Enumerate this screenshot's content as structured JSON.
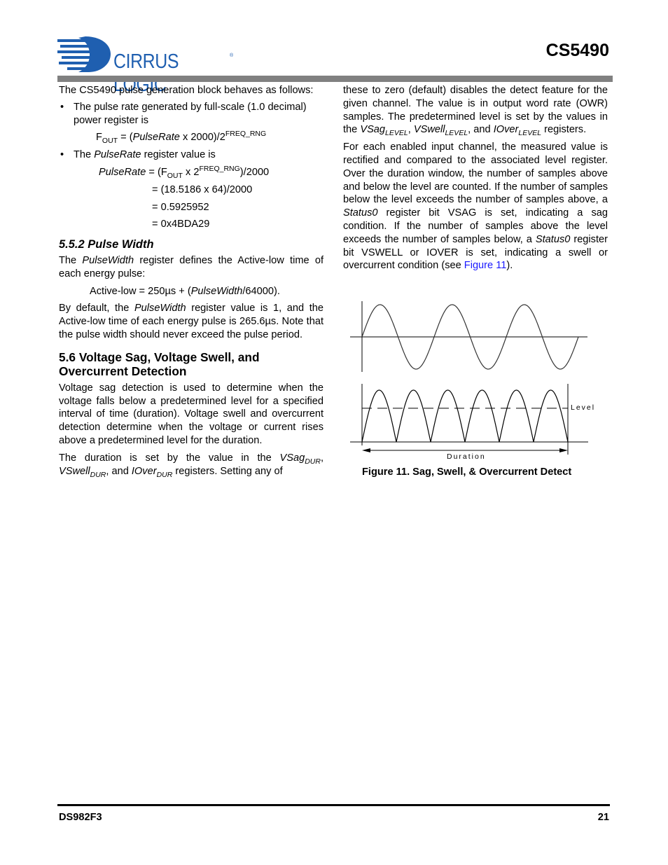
{
  "header": {
    "logo_text": "CIRRUS LOGIC",
    "logo_registered": "®",
    "part_number": "CS5490",
    "brand_color": "#1f5fb0",
    "bar_color": "#808080"
  },
  "left_column": {
    "intro": "The CS5490 pulse generation block behaves as follows:",
    "bullet1": {
      "marker": "•",
      "text": "The pulse rate generated by full-scale (1.0 decimal) power register is",
      "eq": {
        "f": "F",
        "f_sub": "OUT",
        "mid1": " = (",
        "var": "PulseRate",
        "mid2": " x 2000)/2",
        "exp": "FREQ_RNG"
      }
    },
    "bullet2": {
      "marker": "•",
      "text_pre": "The ",
      "text_var": "PulseRate",
      "text_post": " register value is",
      "eq_line1": {
        "var": "PulseRate",
        "mid1": " = (F",
        "sub": "OUT",
        "mid2": " x 2",
        "exp": "FREQ_RNG",
        "end": ")/2000"
      },
      "eq_line2": "= (18.5186 x 64)/2000",
      "eq_line3": "= 0.5925952",
      "eq_line4": "= 0x4BDA29"
    },
    "section_552": {
      "heading": "5.5.2  Pulse Width",
      "p1_pre": "The ",
      "p1_var": "PulseWidth",
      "p1_post": " register defines the Active-low time of each energy pulse:",
      "eq_pre": "Active-low = 250µs + (",
      "eq_var": "PulseWidth",
      "eq_post": "/64000).",
      "p2_pre": "By default, the ",
      "p2_var": "PulseWidth",
      "p2_post": " register value is 1, and the Active-low time of each energy pulse is 265.6µs. Note that the pulse width should never exceed the pulse period."
    },
    "section_56": {
      "heading_line1": "5.6  Voltage Sag, Voltage Swell, and",
      "heading_line2": "Overcurrent Detection",
      "p1": "Voltage sag detection is used to determine when the voltage falls below a predetermined level for a specified interval of time (duration). Voltage swell and overcurrent detection determine when the voltage or current rises above a predetermined level for the duration.",
      "p2_pre": "The duration is set by the value in the ",
      "r1": "VSag",
      "r1_sub": "DUR",
      "sep1": ", ",
      "r2": "VSwell",
      "r2_sub": "DUR",
      "sep2": ", and ",
      "r3": "IOver",
      "r3_sub": "DUR",
      "p2_post": " registers. Setting any of"
    }
  },
  "right_column": {
    "p1_pre": "these to zero (default) disables the detect feature for the given channel. The value is in output word rate (OWR) samples. The predetermined level is set by the values in the ",
    "r1": "VSag",
    "r1_sub": "LEVEL",
    "sep1": ", ",
    "r2": "VSwell",
    "r2_sub": "LEVEL",
    "sep2": ", and ",
    "r3": "IOver",
    "r3_sub": "LEVEL",
    "p1_post": " registers.",
    "p2_a": "For each enabled input channel, the measured value is rectified and compared to the associated level register. Over the duration window, the number of samples above and below the level are counted. If the number of samples below the level exceeds the number of samples above, a ",
    "p2_var1": "Status0",
    "p2_b": " register bit VSAG is set, indicating a sag condition. If the number of samples above the level exceeds the number of samples below, a ",
    "p2_var2": "Status0",
    "p2_c": " register bit VSWELL or IOVER is set, indicating a swell or overcurrent condition (see ",
    "p2_link": "Figure 11",
    "p2_d": ").",
    "link_color": "#1a1aff"
  },
  "figure": {
    "caption": "Figure 11.  Sag, Swell, & Overcurrent Detect",
    "level_label": "Level",
    "duration_label": "Duration",
    "sine_cycles": 3,
    "rectified_half_cycles": 6,
    "level_fraction_of_peak": 0.65
  },
  "footer": {
    "doc_id": "DS982F3",
    "page_number": "21"
  }
}
